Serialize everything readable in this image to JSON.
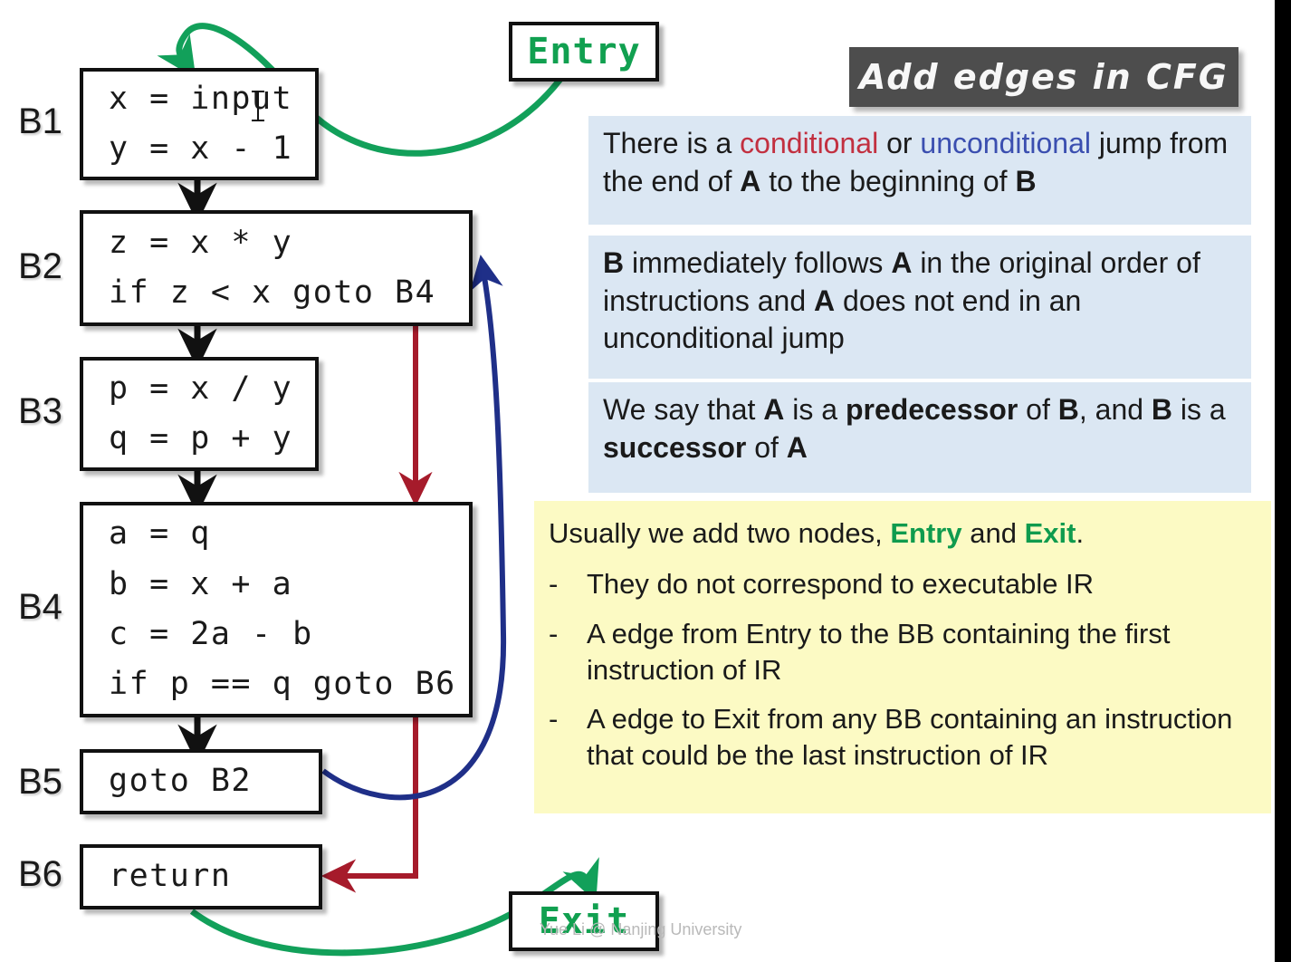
{
  "title": {
    "text": "Add edges in CFG"
  },
  "terminals": {
    "entry": "Entry",
    "exit": "Exit"
  },
  "blocks": [
    {
      "label": "B1",
      "code": "x = input\ny = x - 1"
    },
    {
      "label": "B2",
      "code": "z = x * y\nif z < x goto B4"
    },
    {
      "label": "B3",
      "code": "p = x / y\nq = p + y"
    },
    {
      "label": "B4",
      "code": "a = q\nb = x + a\nc = 2a - b\nif p == q goto B6"
    },
    {
      "label": "B5",
      "code": "goto B2"
    },
    {
      "label": "B6",
      "code": "return"
    }
  ],
  "info_boxes": [
    {
      "segments": [
        {
          "t": "There is a ",
          "style": "plain"
        },
        {
          "t": "conditional",
          "style": "cond"
        },
        {
          "t": " or ",
          "style": "plain"
        },
        {
          "t": "unconditional",
          "style": "uncond"
        },
        {
          "t": " jump from the end of ",
          "style": "plain"
        },
        {
          "t": "A",
          "style": "bold"
        },
        {
          "t": " to the beginning of ",
          "style": "plain"
        },
        {
          "t": "B",
          "style": "bold"
        }
      ]
    },
    {
      "segments": [
        {
          "t": "B",
          "style": "bold"
        },
        {
          "t": " immediately follows ",
          "style": "plain"
        },
        {
          "t": "A",
          "style": "bold"
        },
        {
          "t": " in the original order of instructions and ",
          "style": "plain"
        },
        {
          "t": "A",
          "style": "bold"
        },
        {
          "t": " does not end in an unconditional jump",
          "style": "plain"
        }
      ]
    },
    {
      "segments": [
        {
          "t": "We say that ",
          "style": "plain"
        },
        {
          "t": "A",
          "style": "bold"
        },
        {
          "t": " is a ",
          "style": "plain"
        },
        {
          "t": "predecessor",
          "style": "bold"
        },
        {
          "t": " of ",
          "style": "plain"
        },
        {
          "t": "B",
          "style": "bold"
        },
        {
          "t": ", and ",
          "style": "plain"
        },
        {
          "t": "B",
          "style": "bold"
        },
        {
          "t": " is a ",
          "style": "plain"
        },
        {
          "t": "successor",
          "style": "bold"
        },
        {
          "t": " of ",
          "style": "plain"
        },
        {
          "t": "A",
          "style": "bold"
        }
      ]
    }
  ],
  "note": {
    "heading_parts": [
      {
        "t": "Usually we add two nodes, ",
        "style": "plain"
      },
      {
        "t": "Entry",
        "style": "green"
      },
      {
        "t": " and ",
        "style": "plain"
      },
      {
        "t": "Exit",
        "style": "green"
      },
      {
        "t": ".",
        "style": "plain"
      }
    ],
    "dash": "-",
    "items": [
      "They do not correspond to executable IR",
      "A edge from Entry to the BB containing the first instruction of IR",
      "A edge to Exit from any BB containing an instruction that could be the last instruction of IR"
    ]
  },
  "watermark": {
    "text": "Yue Li @ Nanjing University"
  },
  "colors": {
    "entry_exit_green": "#11a050",
    "edge_green": "#12a05a",
    "edge_red": "#a61b2b",
    "edge_blue": "#1f2f88",
    "edge_black": "#111111",
    "banner_bg": "#4d4d4d",
    "info_bg": "#dbe7f3",
    "note_bg": "#fcfac4",
    "conditional_red": "#c23040",
    "unconditional_blue": "#3b4fb0"
  }
}
